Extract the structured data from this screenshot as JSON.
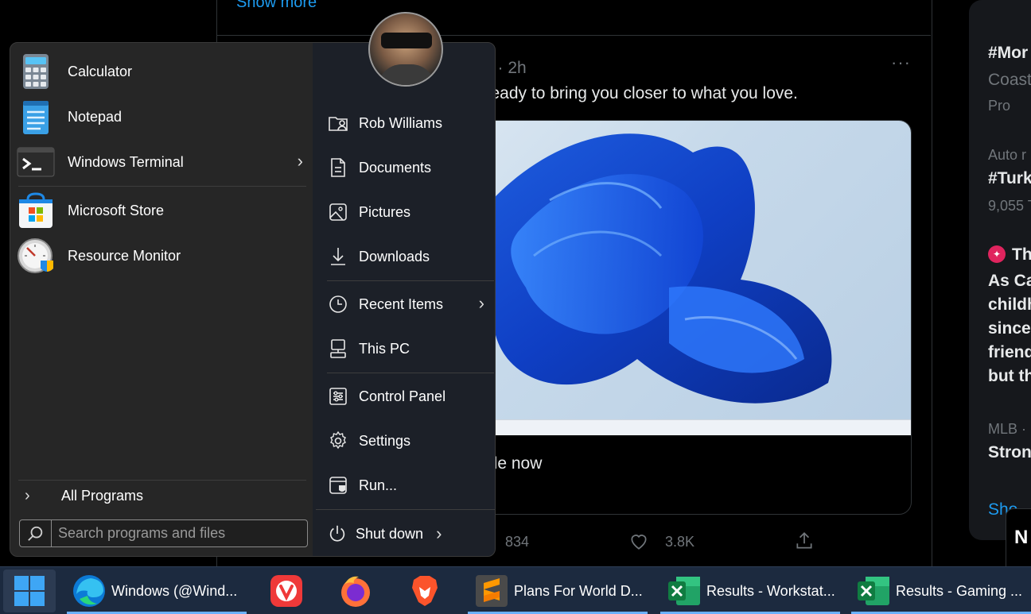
{
  "background": {
    "show_more_top": "Show more",
    "tweet_meta": "ws · 2h",
    "tweet_more": "···",
    "tweet_text": "d ready to bring you closer to what you love.",
    "card_text": "ble now",
    "replies": "834",
    "likes": "3.8K",
    "right_col": {
      "line1": "#Mor",
      "line2": "Coast",
      "line3": "Pro",
      "line4": "Auto r",
      "line5": "#Turk",
      "line6": "9,055 T",
      "line7": "Th",
      "line8": "As Ca",
      "line9": "childh",
      "line10": "since",
      "line11": "friend",
      "line12": "but th",
      "line13": "MLB ·",
      "line14": "Stron",
      "line15": "Sho",
      "chip": "N"
    }
  },
  "start_menu": {
    "apps": [
      {
        "label": "Calculator",
        "icon": "calculator-icon"
      },
      {
        "label": "Notepad",
        "icon": "notepad-icon"
      },
      {
        "label": "Windows Terminal",
        "icon": "terminal-icon",
        "has_submenu": true
      },
      {
        "label": "Microsoft Store",
        "icon": "store-icon"
      },
      {
        "label": "Resource Monitor",
        "icon": "resource-monitor-icon"
      }
    ],
    "all_programs": "All Programs",
    "search": {
      "placeholder": "Search programs and files",
      "value": ""
    },
    "links": [
      {
        "label": "Rob Williams",
        "icon": "user-folder-icon"
      },
      {
        "label": "Documents",
        "icon": "document-icon"
      },
      {
        "label": "Pictures",
        "icon": "picture-icon"
      },
      {
        "label": "Downloads",
        "icon": "download-icon"
      },
      {
        "label": "Recent Items",
        "icon": "clock-icon",
        "has_submenu": true
      },
      {
        "label": "This PC",
        "icon": "computer-icon"
      },
      {
        "label": "Control Panel",
        "icon": "control-panel-icon"
      },
      {
        "label": "Settings",
        "icon": "gear-icon"
      },
      {
        "label": "Run...",
        "icon": "run-icon"
      }
    ],
    "shutdown": "Shut down"
  },
  "taskbar": {
    "items": [
      {
        "label": "Windows (@Wind...",
        "icon": "edge-icon"
      },
      {
        "label": "",
        "icon": "vivaldi-icon"
      },
      {
        "label": "",
        "icon": "firefox-icon"
      },
      {
        "label": "",
        "icon": "brave-icon"
      },
      {
        "label": "Plans For World D...",
        "icon": "sublime-text-icon"
      },
      {
        "label": "Results - Workstat...",
        "icon": "excel-icon"
      },
      {
        "label": "Results - Gaming ...",
        "icon": "excel-icon"
      }
    ]
  }
}
